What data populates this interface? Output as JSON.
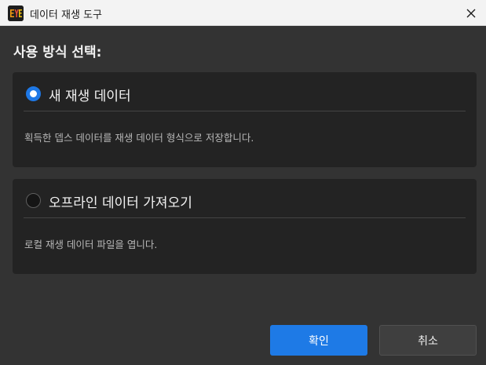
{
  "window": {
    "title": "데이터 재생 도구",
    "logo_icon": "eye-logo-icon",
    "close_icon": "close-icon"
  },
  "heading": "사용 방식 선택:",
  "options": [
    {
      "label": "새 재생 데이터",
      "description": "획득한 뎁스 데이터를 재생 데이터 형식으로 저장합니다.",
      "selected": true
    },
    {
      "label": "오프라인 데이터 가져오기",
      "description": "로컬 재생 데이터 파일을 엽니다.",
      "selected": false
    }
  ],
  "buttons": {
    "confirm": "확인",
    "cancel": "취소"
  },
  "colors": {
    "accent": "#1e7ae6",
    "background": "#333333",
    "card": "#232323",
    "titlebar": "#f3f3f3"
  }
}
